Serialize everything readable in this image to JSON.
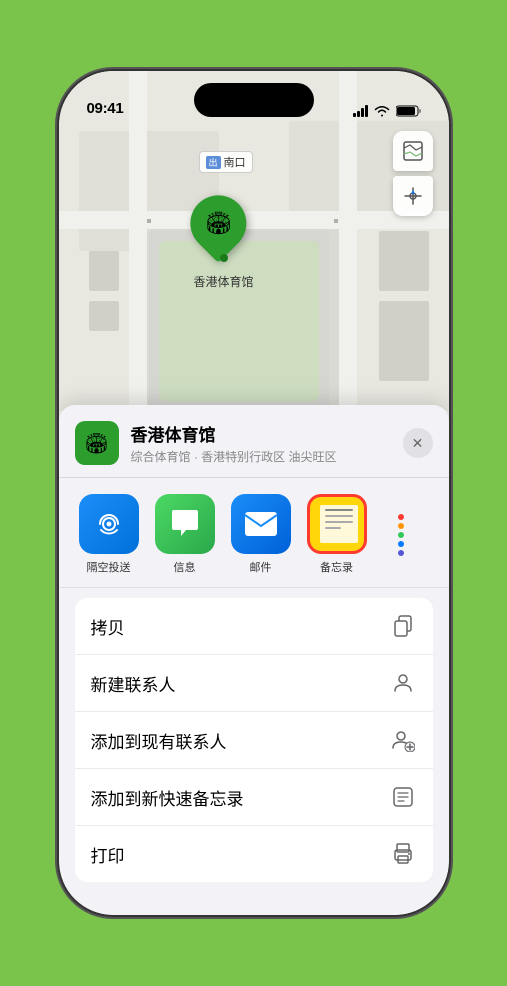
{
  "phone": {
    "status_bar": {
      "time": "09:41",
      "signal_label": "signal",
      "wifi_label": "wifi",
      "battery_label": "battery"
    },
    "map": {
      "location_name": "香港体育馆",
      "map_label": "南口",
      "direction": "出",
      "btn_map": "🗺",
      "btn_compass": "◎"
    },
    "sheet": {
      "title": "香港体育馆",
      "subtitle": "综合体育馆 · 香港特别行政区 油尖旺区",
      "close_label": "✕",
      "icon_emoji": "🏟"
    },
    "apps": [
      {
        "id": "airdrop",
        "label": "隔空投送",
        "emoji": ""
      },
      {
        "id": "messages",
        "label": "信息",
        "emoji": "💬"
      },
      {
        "id": "mail",
        "label": "邮件",
        "emoji": "✉"
      },
      {
        "id": "notes",
        "label": "备忘录",
        "emoji": ""
      }
    ],
    "actions": [
      {
        "label": "拷贝",
        "icon": "copy"
      },
      {
        "label": "新建联系人",
        "icon": "person"
      },
      {
        "label": "添加到现有联系人",
        "icon": "person-add"
      },
      {
        "label": "添加到新快速备忘录",
        "icon": "note"
      },
      {
        "label": "打印",
        "icon": "print"
      }
    ],
    "more_dots": [
      {
        "color": "#ff3b30"
      },
      {
        "color": "#ff9500"
      },
      {
        "color": "#34c759"
      },
      {
        "color": "#007aff"
      },
      {
        "color": "#5856d6"
      }
    ]
  }
}
